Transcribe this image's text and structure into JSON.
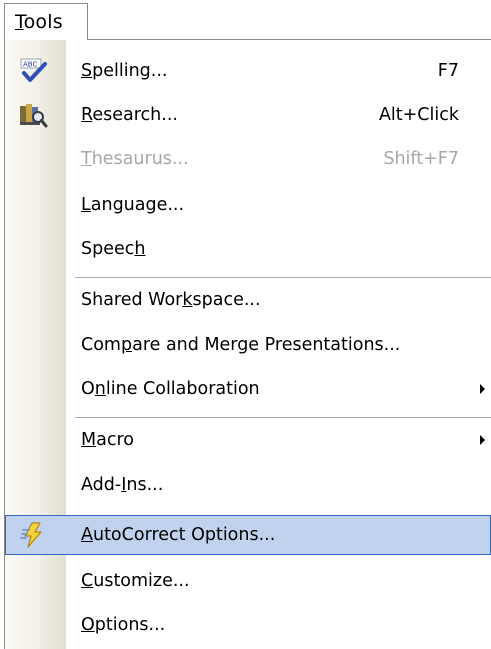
{
  "menu": {
    "title_prefix": "",
    "title_u": "T",
    "title_rest": "ools"
  },
  "items": [
    {
      "pre": "",
      "u": "S",
      "post": "pelling...",
      "shortcut": "F7",
      "icon": "spelling-abc-check-icon"
    },
    {
      "pre": "",
      "u": "R",
      "post": "esearch...",
      "shortcut": "Alt+Click",
      "icon": "research-books-magnifier-icon"
    },
    {
      "pre": "",
      "u": "T",
      "post": "hesaurus...",
      "shortcut": "Shift+F7",
      "disabled": true
    },
    {
      "pre": "",
      "u": "L",
      "post": "anguage..."
    },
    {
      "pre": "Speec",
      "u": "h",
      "post": ""
    },
    {
      "pre": "Shared Wor",
      "u": "k",
      "post": "space..."
    },
    {
      "pre": "Com",
      "u": "p",
      "post": "are and Merge Presentations..."
    },
    {
      "pre": "O",
      "u": "n",
      "post": "line Collaboration",
      "submenu": true
    },
    {
      "pre": "",
      "u": "M",
      "post": "acro",
      "submenu": true
    },
    {
      "pre": "Add-",
      "u": "I",
      "post": "ns..."
    },
    {
      "pre": "",
      "u": "A",
      "post": "utoCorrect Options...",
      "icon": "autocorrect-lightning-icon",
      "highlighted": true
    },
    {
      "pre": "",
      "u": "C",
      "post": "ustomize..."
    },
    {
      "pre": "",
      "u": "O",
      "post": "ptions..."
    }
  ]
}
